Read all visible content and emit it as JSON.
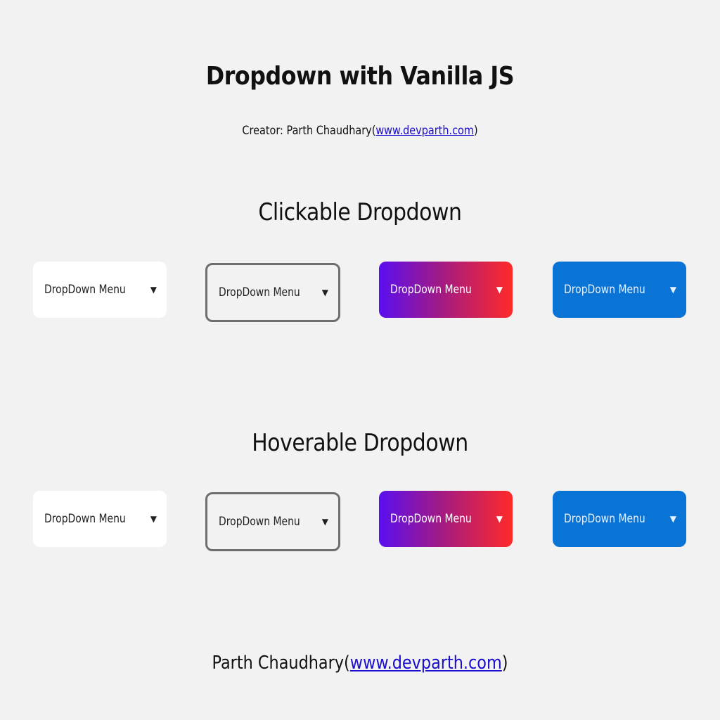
{
  "header": {
    "title": "Dropdown with Vanilla JS",
    "creator_prefix": "Creator: Parth Chaudhary(",
    "creator_link": "www.devparth.com",
    "creator_suffix": ")"
  },
  "sections": {
    "clickable": {
      "title": "Clickable Dropdown",
      "dropdowns": [
        {
          "label": "DropDown Menu",
          "caret": "▼"
        },
        {
          "label": "DropDown Menu",
          "caret": "▼"
        },
        {
          "label": "DropDown Menu",
          "caret": "▼"
        },
        {
          "label": "DropDown Menu",
          "caret": "▼"
        }
      ]
    },
    "hoverable": {
      "title": "Hoverable Dropdown",
      "dropdowns": [
        {
          "label": "DropDown Menu",
          "caret": "▼"
        },
        {
          "label": "DropDown Menu",
          "caret": "▼"
        },
        {
          "label": "DropDown Menu",
          "caret": "▼"
        },
        {
          "label": "DropDown Menu",
          "caret": "▼"
        }
      ]
    }
  },
  "footer": {
    "name": "Parth Chaudhary(",
    "link": "www.devparth.com",
    "suffix": ")"
  },
  "colors": {
    "background": "#f2f2f2",
    "white_button": "#ffffff",
    "outline_border": "#6e6e6e",
    "gradient_start": "#5a0ff0",
    "gradient_end": "#ff2a2a",
    "blue_button": "#0a73d6",
    "link": "#1a0dcc"
  },
  "icons": {
    "caret": "caret-down-icon"
  }
}
